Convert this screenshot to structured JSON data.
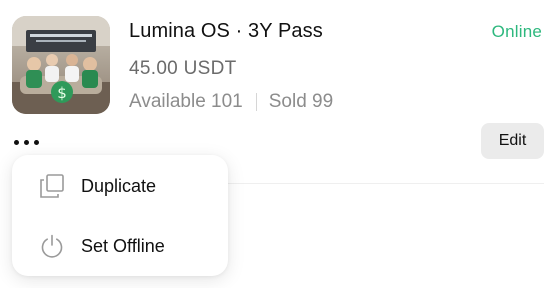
{
  "product": {
    "title": "Lumina OS · 3Y Pass",
    "price": "45.00 USDT",
    "available": "Available 101",
    "sold": "Sold 99",
    "status": "Online",
    "status_color": "#2eb87e",
    "thumbnail_icon": "product-thumbnail"
  },
  "actions": {
    "more_icon": "more-dots-icon",
    "edit_label": "Edit"
  },
  "menu": {
    "items": [
      {
        "label": "Duplicate",
        "icon": "duplicate-icon"
      },
      {
        "label": "Set Offline",
        "icon": "power-icon"
      }
    ]
  }
}
